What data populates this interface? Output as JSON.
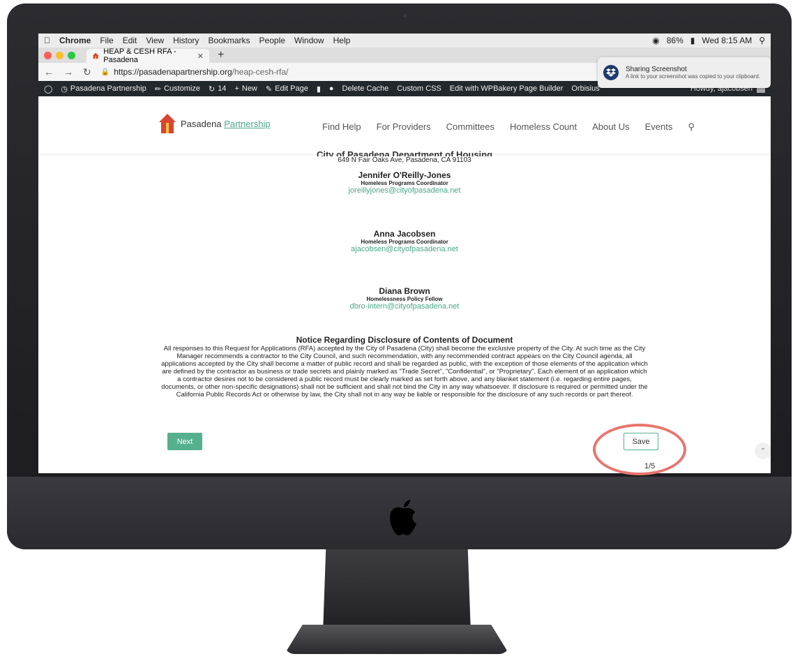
{
  "menubar": {
    "app": "Chrome",
    "items": [
      "File",
      "Edit",
      "View",
      "History",
      "Bookmarks",
      "People",
      "Window",
      "Help"
    ],
    "battery": "86%",
    "clock": "Wed 8:15 AM"
  },
  "browser": {
    "tab_title": "HEAP & CESH RFA - Pasadena",
    "url_host": "https://pasadenapartnership.org",
    "url_path": "/heap-cesh-rfa/"
  },
  "notification": {
    "title": "Sharing Screenshot",
    "body": "A link to your screenshot was copied to your clipboard."
  },
  "wp_admin_bar": {
    "site": "Pasadena Partnership",
    "customize": "Customize",
    "updates": "14",
    "new": "New",
    "edit_page": "Edit Page",
    "delete_cache": "Delete Cache",
    "custom_css": "Custom CSS",
    "wpbakery": "Edit with WPBakery Page Builder",
    "orbisius": "Orbisius",
    "howdy": "Howdy, ajacobsen"
  },
  "site": {
    "logo_part1": "Pasadena",
    "logo_part2": "Partnership",
    "nav": [
      "Find Help",
      "For Providers",
      "Committees",
      "Homeless Count",
      "About Us",
      "Events"
    ]
  },
  "content": {
    "cut_heading": "City of Pasadena Department of Housing",
    "address": "649 N Fair Oaks Ave, Pasadena, CA 91103",
    "contacts": [
      {
        "name": "Jennifer O'Reilly-Jones",
        "title": "Homeless Programs Coordinator",
        "email": "joreillyjones@cityofpasadena.net"
      },
      {
        "name": "Anna Jacobsen",
        "title": "Homeless Programs Coordinator",
        "email": "ajacobsen@cityofpasadena.net"
      },
      {
        "name": "Diana Brown",
        "title": "Homelessness Policy Fellow",
        "email": "dbro-intern@cityofpasadena.net"
      }
    ],
    "notice_title": "Notice Regarding Disclosure of Contents of Document",
    "notice_body": "All responses to this Request for Applications (RFA) accepted by the City of Pasadena (City) shall become the exclusive property of the City. At such time as the City Manager recommends a contractor to the City Council, and such recommendation, with any recommended contract appears on the City Council agenda, all applications accepted by the City shall become a matter of public record and shall be regarded as public, with the exception of those elements of the application which are defined by the contractor as business or trade secrets and plainly marked as \"Trade Secret\", \"Confidential\", or \"Proprietary\". Each element of an application which a contractor desires not to be considered a public record must be clearly marked as set forth above, and any blanket statement (i.e. regarding entire pages, documents, or other non-specific designations) shall not be sufficient and shall not bind the City in any way whatsoever. If disclosure is required or permitted under the California Public Records Act or otherwise by law, the City shall not in any way be liable or responsible for the disclosure of any such records or part thereof.",
    "next_label": "Next",
    "save_label": "Save",
    "page_count": "1/5"
  },
  "colors": {
    "accent": "#55b08e",
    "link": "#4aa68a",
    "annotation": "#e8756f"
  }
}
